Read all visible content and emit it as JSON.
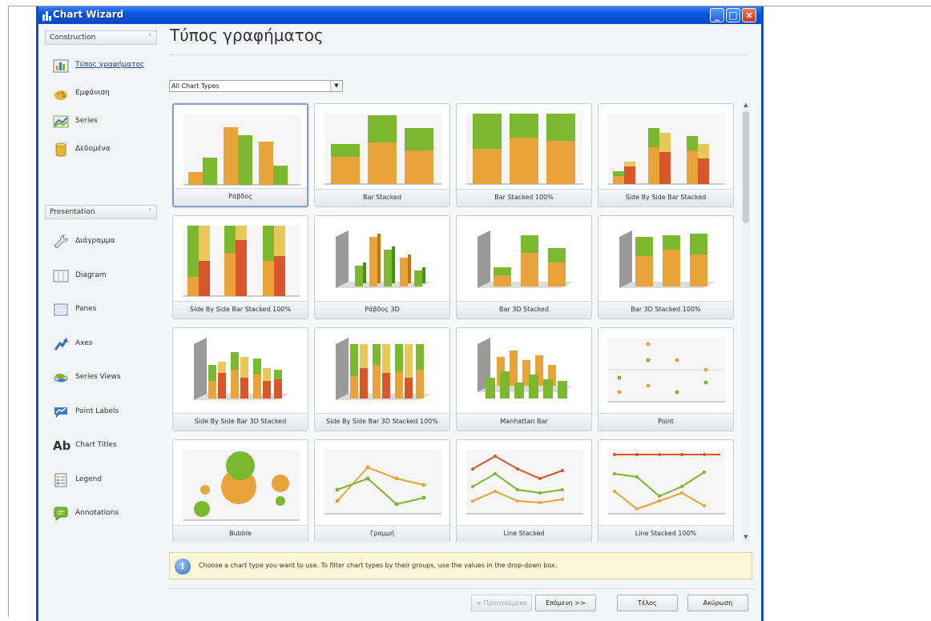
{
  "window": {
    "title": "Chart Wizard"
  },
  "sidebar": {
    "groups": [
      {
        "label": "Construction"
      },
      {
        "label": "Presentation"
      }
    ],
    "construction_items": [
      {
        "label": "Τύπος γραφήματος",
        "icon": "chart-type-icon"
      },
      {
        "label": "Εμφάνιση",
        "icon": "appearance-icon"
      },
      {
        "label": "Series",
        "icon": "series-icon"
      },
      {
        "label": "Δεδομένα",
        "icon": "data-icon"
      }
    ],
    "presentation_items": [
      {
        "label": "Διάγραμμα",
        "icon": "wrench-icon"
      },
      {
        "label": "Diagram",
        "icon": "diagram-icon"
      },
      {
        "label": "Panes",
        "icon": "panes-icon"
      },
      {
        "label": "Axes",
        "icon": "axes-icon"
      },
      {
        "label": "Series Views",
        "icon": "series-views-icon"
      },
      {
        "label": "Point Labels",
        "icon": "point-labels-icon"
      },
      {
        "label": "Chart Titles",
        "icon": "chart-titles-icon"
      },
      {
        "label": "Legend",
        "icon": "legend-icon"
      },
      {
        "label": "Annotations",
        "icon": "annotations-icon"
      }
    ]
  },
  "main": {
    "page_title": "Τύπος γραφήματος",
    "filter": {
      "selected": "All Chart Types"
    },
    "chart_types": [
      "Ράβδος",
      "Bar Stacked",
      "Bar Stacked 100%",
      "Side By Side Bar Stacked",
      "Side By Side Bar Stacked 100%",
      "Ράβδος 3D",
      "Bar 3D Stacked",
      "Bar 3D Stacked 100%",
      "Side By Side Bar 3D Stacked",
      "Side By Side Bar 3D Stacked 100%",
      "Manhattan Bar",
      "Point",
      "Bubble",
      "Γραμμή",
      "Line Stacked",
      "Line Stacked 100%"
    ],
    "hint": "Choose a chart type you want to use. To filter chart types by their groups, use the values in the drop-down box."
  },
  "buttons": {
    "previous": "< Προηγούμενο",
    "next": "Επόμενη >>",
    "finish": "Τέλος",
    "cancel": "Ακύρωση"
  },
  "colors": {
    "green": "#7cb82f",
    "orange": "#e8a33a",
    "red": "#d9552a",
    "yellow": "#e8c85a",
    "titlebar": "#0a56e0"
  }
}
